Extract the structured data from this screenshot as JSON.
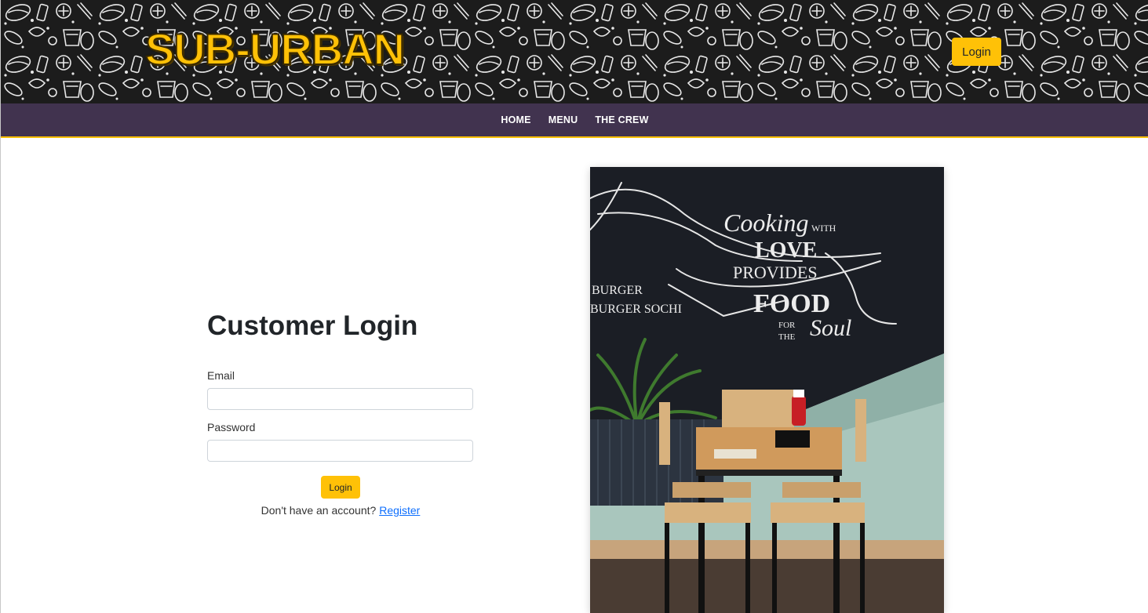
{
  "header": {
    "brand": "SUB-URBAN",
    "login_button": "Login"
  },
  "nav": {
    "items": [
      "HOME",
      "MENU",
      "THE CREW"
    ]
  },
  "login_form": {
    "title": "Customer Login",
    "email_label": "Email",
    "email_value": "",
    "password_label": "Password",
    "password_value": "",
    "submit_label": "Login",
    "register_prompt": "Don't have an account?",
    "register_link": "Register"
  },
  "photo": {
    "mural_text": {
      "line1": "Cooking",
      "line2": "WITH",
      "line3": "LOVE",
      "line4": "PROVIDES",
      "line5": "FOOD",
      "line6": "FOR",
      "line7": "THE",
      "line8": "Soul",
      "side1": "BURGER",
      "side2": "BURGER SOCHI"
    }
  },
  "colors": {
    "accent": "#ffc107",
    "nav_bg": "#41334f",
    "header_bg": "#1c1c1c",
    "link": "#0d6efd"
  }
}
